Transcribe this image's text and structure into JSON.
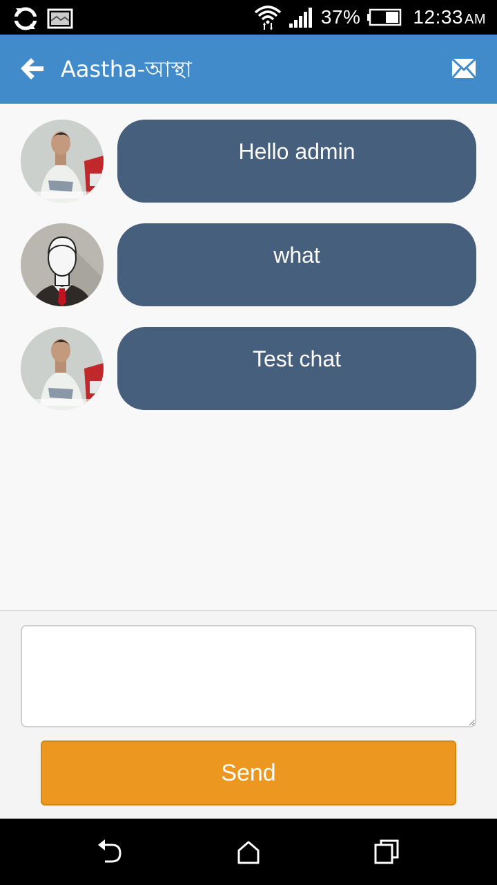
{
  "status_bar": {
    "battery_percent": "37%",
    "time": "12:33",
    "ampm": "AM",
    "icons": [
      "sync-icon",
      "image-notification-icon",
      "wifi-icon",
      "signal-icon",
      "battery-icon"
    ]
  },
  "app_bar": {
    "title": "Aastha-আস্থা",
    "color": "#428bca",
    "icons": [
      "back-arrow-icon",
      "mail-icon"
    ]
  },
  "messages": [
    {
      "text": "Hello admin",
      "avatar": "ronaldo-photo-avatar"
    },
    {
      "text": "what",
      "avatar": "default-user-avatar"
    },
    {
      "text": "Test chat",
      "avatar": "ronaldo-photo-avatar"
    }
  ],
  "colors": {
    "bubble": "#455f7c",
    "send_button": "#ec971f"
  },
  "compose": {
    "input_value": "",
    "send_label": "Send"
  },
  "nav_bar": {
    "icons": [
      "back-icon",
      "home-icon",
      "recents-icon"
    ]
  }
}
